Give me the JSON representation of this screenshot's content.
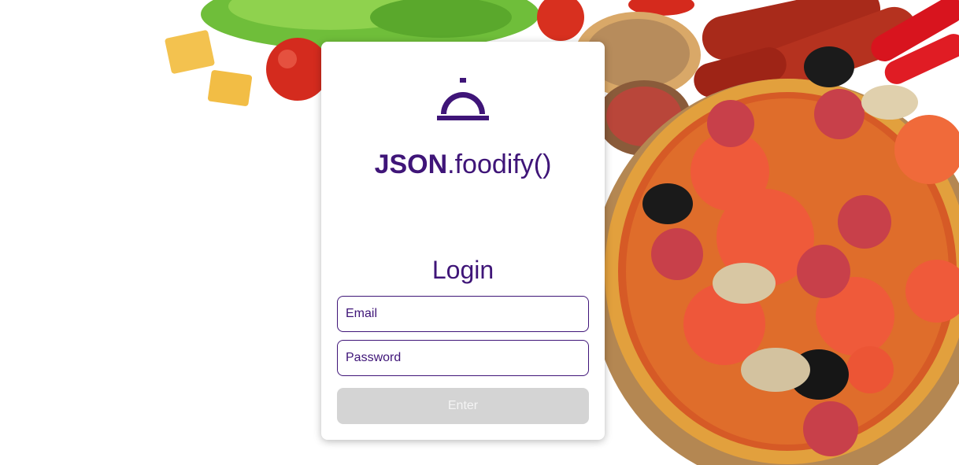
{
  "app": {
    "brand_bold": "JSON",
    "brand_rest": ".foodify()",
    "logo_icon": "cloche-icon"
  },
  "login": {
    "title": "Login",
    "email_placeholder": "Email",
    "password_placeholder": "Password",
    "submit_label": "Enter",
    "submit_disabled": true
  },
  "background": {
    "image": "pizza-and-ingredients-photo"
  },
  "colors": {
    "accent": "#3f1578",
    "button_disabled": "#d4d4d4",
    "button_text_disabled": "#f4f4f4"
  }
}
